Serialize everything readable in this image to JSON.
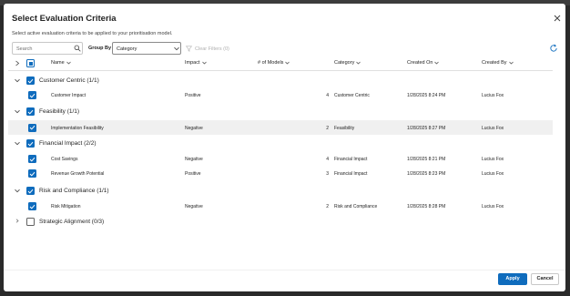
{
  "dialog": {
    "title": "Select Evaluation Criteria",
    "subtitle": "Select active evaluation criteria to be applied to your prioritisation model.",
    "close_icon": "close-icon"
  },
  "toolbar": {
    "search_placeholder": "Search",
    "group_by_label": "Group By",
    "group_by_value": "Category",
    "clear_filters_label": "Clear Filters (0)"
  },
  "columns": {
    "name": "Name",
    "impact": "Impact",
    "models": "# of Models",
    "category": "Category",
    "created_on": "Created On",
    "created_by": "Created By"
  },
  "groups": [
    {
      "label": "Customer Centric (1/1)",
      "rows": [
        {
          "name": "Customer Impact",
          "impact": "Positive",
          "models": "4",
          "category": "Customer Centric",
          "created_on": "1/28/2025 8:24 PM",
          "created_by": "Lucius Fox"
        }
      ]
    },
    {
      "label": "Feasibility (1/1)",
      "rows": [
        {
          "name": "Implementation Feasibility",
          "impact": "Negative",
          "models": "2",
          "category": "Feasibility",
          "created_on": "1/28/2025 8:27 PM",
          "created_by": "Lucius Fox"
        }
      ]
    },
    {
      "label": "Financial Impact (2/2)",
      "rows": [
        {
          "name": "Cost Savings",
          "impact": "Negative",
          "models": "4",
          "category": "Financial Impact",
          "created_on": "1/28/2025 8:21 PM",
          "created_by": "Lucius Fox"
        },
        {
          "name": "Revenue Growth Potential",
          "impact": "Positive",
          "models": "3",
          "category": "Financial Impact",
          "created_on": "1/28/2025 8:23 PM",
          "created_by": "Lucius Fox"
        }
      ]
    },
    {
      "label": "Risk and Compliance (1/1)",
      "rows": [
        {
          "name": "Risk Mitigation",
          "impact": "Negative",
          "models": "2",
          "category": "Risk and Compliance",
          "created_on": "1/28/2025 8:28 PM",
          "created_by": "Lucius Fox"
        }
      ]
    },
    {
      "label": "Strategic Alignment (0/3)",
      "rows": []
    }
  ],
  "footer": {
    "apply_label": "Apply",
    "cancel_label": "Cancel"
  },
  "colors": {
    "accent": "#0f6cbd",
    "row_highlight": "#f0f0f0"
  }
}
